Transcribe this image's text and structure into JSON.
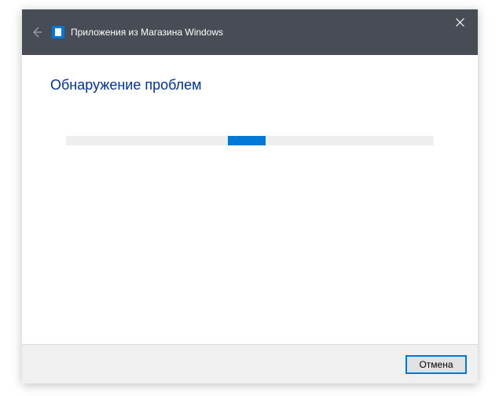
{
  "titlebar": {
    "title": "Приложения из Магазина Windows"
  },
  "content": {
    "heading": "Обнаружение проблем"
  },
  "footer": {
    "cancel_label": "Отмена"
  }
}
